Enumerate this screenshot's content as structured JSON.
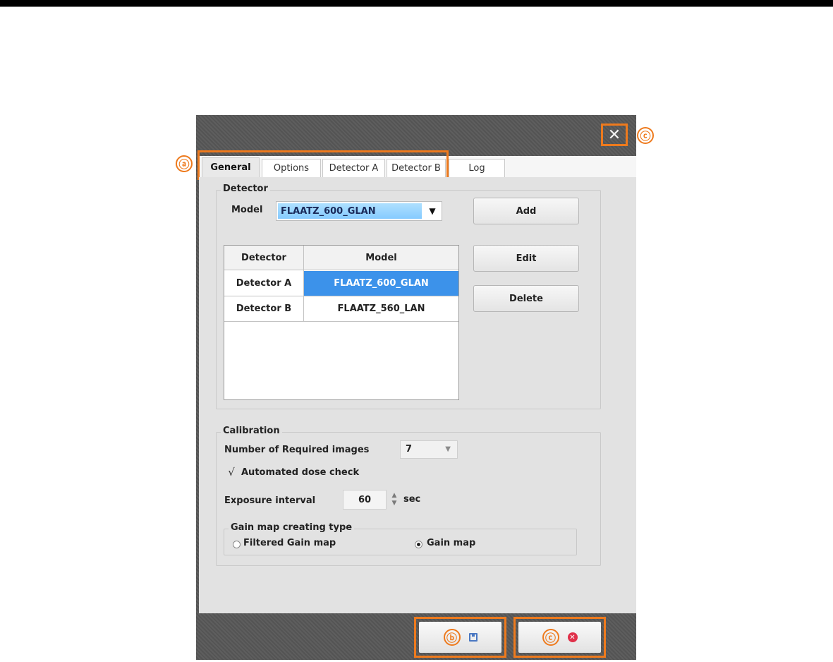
{
  "dialog": {
    "close_glyph": "✕",
    "callouts": {
      "tabs": "ⓐ",
      "save": "ⓑ",
      "close": "ⓒ",
      "cancel": "ⓒ"
    }
  },
  "tabs": [
    {
      "label": "General",
      "active": true
    },
    {
      "label": "Options",
      "active": false
    },
    {
      "label": "Detector A",
      "active": false
    },
    {
      "label": "Detector B",
      "active": false
    },
    {
      "label": "Log",
      "active": false
    }
  ],
  "detector": {
    "group_title": "Detector",
    "model_label": "Model",
    "model_value": "FLAATZ_600_GLAN",
    "add_label": "Add",
    "edit_label": "Edit",
    "delete_label": "Delete",
    "table": {
      "headers": [
        "Detector",
        "Model"
      ],
      "rows": [
        {
          "detector": "Detector A",
          "model": "FLAATZ_600_GLAN",
          "selected": true
        },
        {
          "detector": "Detector B",
          "model": "FLAATZ_560_LAN",
          "selected": false
        }
      ]
    }
  },
  "calibration": {
    "group_title": "Calibration",
    "required_images_label": "Number of Required images",
    "required_images_value": "7",
    "dose_check_label": "Automated dose check",
    "dose_check_checked": true,
    "exposure_label": "Exposure interval",
    "exposure_value": "60",
    "exposure_unit": "sec",
    "gain_group_title": "Gain map creating type",
    "gain_options": [
      {
        "label": "Filtered Gain map",
        "selected": false
      },
      {
        "label": "Gain map",
        "selected": true
      }
    ]
  },
  "colors": {
    "accent": "#ee7a1d",
    "selection": "#3c92ea"
  }
}
